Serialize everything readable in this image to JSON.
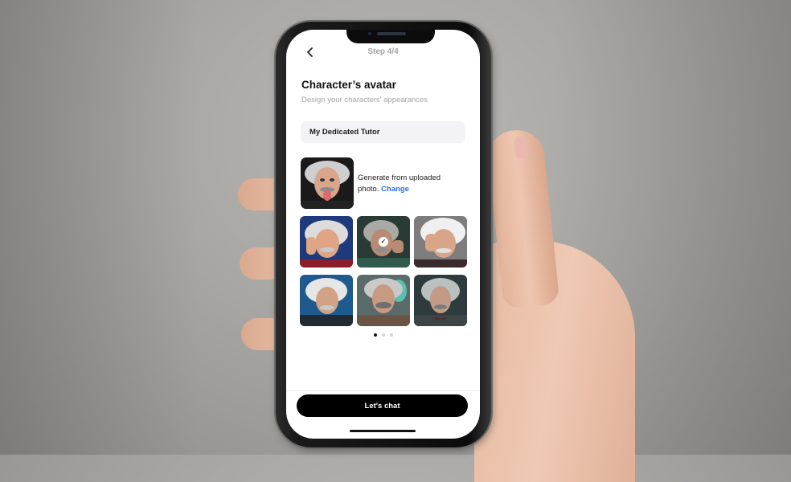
{
  "header": {
    "back_icon": "chevron-left-icon",
    "step_label": "Step 4/4"
  },
  "page": {
    "title": "Character’s avatar",
    "subtitle": "Design your characters' appearances"
  },
  "name_field": {
    "value": "My Dedicated Tutor",
    "placeholder": ""
  },
  "upload": {
    "text": "Generate from uploaded photo.",
    "change_label": "Change"
  },
  "avatars": [
    {
      "id": "avatar-1",
      "selected": false,
      "bg": "#1e3a7a"
    },
    {
      "id": "avatar-2",
      "selected": true,
      "bg": "#2a3a34"
    },
    {
      "id": "avatar-3",
      "selected": false,
      "bg": "#8a8a8a"
    },
    {
      "id": "avatar-4",
      "selected": false,
      "bg": "#1f5a8f"
    },
    {
      "id": "avatar-5",
      "selected": false,
      "bg": "#5b6b6a"
    },
    {
      "id": "avatar-6",
      "selected": false,
      "bg": "#2d3b3d"
    }
  ],
  "pagination": {
    "total": 3,
    "current": 1
  },
  "cta": {
    "label": "Let's chat"
  },
  "colors": {
    "accent": "#2f6cf0",
    "cta_bg": "#000000",
    "field_bg": "#f3f3f5"
  }
}
